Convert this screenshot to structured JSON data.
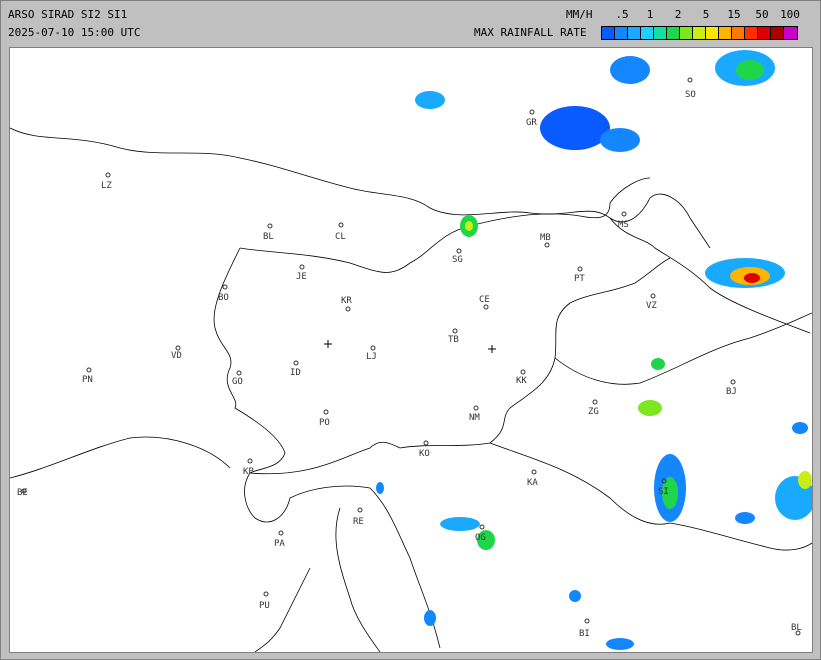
{
  "header": {
    "title": "ARSO SIRAD SI2 SI1",
    "timestamp": "2025-07-10 15:00 UTC",
    "unit": "MM/H",
    "rate_label": "MAX RAINFALL RATE"
  },
  "legend": {
    "ticks": [
      ".5",
      "1",
      "2",
      "5",
      "15",
      "50",
      "100"
    ],
    "colors": [
      "#0a5bff",
      "#1487ff",
      "#19aaff",
      "#1ecfff",
      "#14e0a0",
      "#1fd64a",
      "#7ce61f",
      "#c8ee14",
      "#ffe600",
      "#ffb400",
      "#ff7800",
      "#ff2d00",
      "#dc0000",
      "#aa0000",
      "#c800c8"
    ]
  },
  "map": {
    "cities": [
      {
        "code": "SO"
      },
      {
        "code": "GR"
      },
      {
        "code": "LZ"
      },
      {
        "code": "BL"
      },
      {
        "code": "CL"
      },
      {
        "code": "MS"
      },
      {
        "code": "MB"
      },
      {
        "code": "SG"
      },
      {
        "code": "JE"
      },
      {
        "code": "PT"
      },
      {
        "code": "BO"
      },
      {
        "code": "KR"
      },
      {
        "code": "CE"
      },
      {
        "code": "VZ"
      },
      {
        "code": "TB"
      },
      {
        "code": "VD"
      },
      {
        "code": "LJ"
      },
      {
        "code": "PN"
      },
      {
        "code": "GO"
      },
      {
        "code": "ID"
      },
      {
        "code": "KK"
      },
      {
        "code": "BJ"
      },
      {
        "code": "PO"
      },
      {
        "code": "NM"
      },
      {
        "code": "ZG"
      },
      {
        "code": "KO"
      },
      {
        "code": "KP"
      },
      {
        "code": "KA"
      },
      {
        "code": "SI"
      },
      {
        "code": "BE"
      },
      {
        "code": "RE"
      },
      {
        "code": "PA"
      },
      {
        "code": "OG"
      },
      {
        "code": "PU"
      },
      {
        "code": "BI"
      },
      {
        "code": "BL"
      }
    ]
  }
}
